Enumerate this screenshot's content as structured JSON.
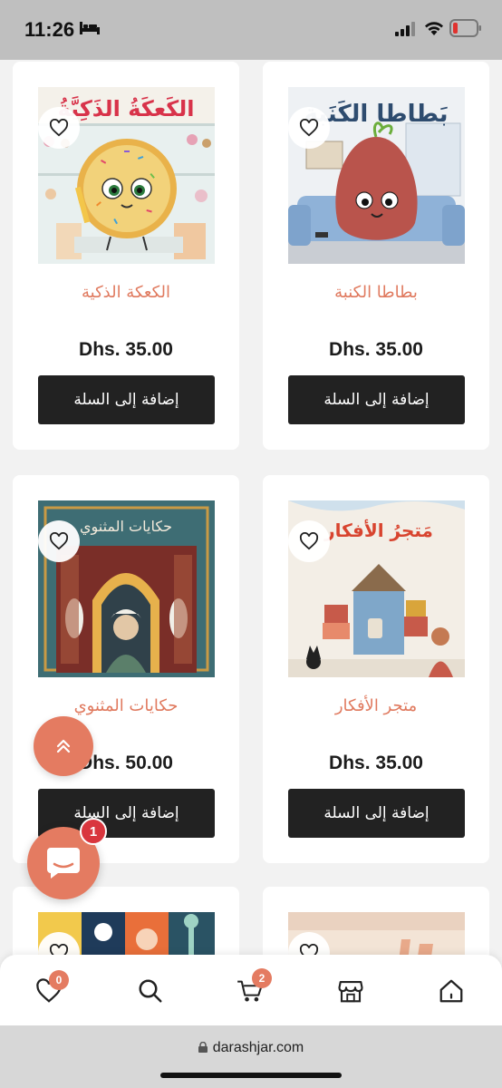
{
  "status_bar": {
    "time": "11:26"
  },
  "products": [
    {
      "title": "الكعكة الذكية",
      "price": "Dhs. 35.00",
      "button": "إضافة إلى السلة",
      "cover_text": "الكَعكَةُ الذَكِيَّةُ"
    },
    {
      "title": "بطاطا الكنبة",
      "price": "Dhs. 35.00",
      "button": "إضافة إلى السلة",
      "cover_text": "بَطاطا الكَنَبة"
    },
    {
      "title": "حكايات المثنوي",
      "price": "Dhs. 50.00",
      "button": "إضافة إلى السلة",
      "cover_text": "حكايات المثنوي"
    },
    {
      "title": "متجر الأفكار",
      "price": "Dhs. 35.00",
      "button": "إضافة إلى السلة",
      "cover_text": "مَتجرُ الأفكار"
    }
  ],
  "bottom_nav": {
    "wishlist_count": "0",
    "cart_count": "2"
  },
  "chat": {
    "badge": "1"
  },
  "browser": {
    "url": "darashjar.com"
  }
}
